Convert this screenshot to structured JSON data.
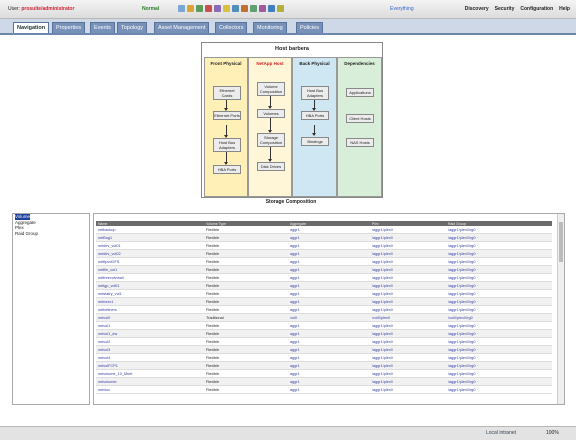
{
  "header": {
    "user_label": "User:",
    "user_value": "prosuite/administrator",
    "mode": "Normal",
    "everything": "Everything",
    "links": [
      "Discovery",
      "Security",
      "Configuration",
      "Help"
    ]
  },
  "tabs": [
    "Navigation",
    "Properties",
    "Events",
    "Topology",
    "Asset Management",
    "Collectors",
    "Monitoring",
    "Policies"
  ],
  "diagram": {
    "title": "Host barbera",
    "columns": [
      {
        "title": "Front Physical",
        "items": [
          "Ethernet Cards",
          "Ethernet Ports",
          "Host Bus Adapters",
          "HBA Ports"
        ]
      },
      {
        "title": "NetApp Host",
        "items": [
          "Volume Composition",
          "Volumes",
          "Storage Composition",
          "Disk Drives"
        ]
      },
      {
        "title": "Back Physical",
        "items": [
          "Host Bus Adapters",
          "HBA Ports",
          "Bindings"
        ]
      },
      {
        "title": "Dependencies",
        "items": [
          "Applications",
          "Client Hosts",
          "NAS Hosts"
        ]
      }
    ]
  },
  "storage_title": "Storage Composition",
  "tree": {
    "items": [
      "Volume",
      "Aggregate",
      "Plex",
      "Raid Group"
    ]
  },
  "table": {
    "headers": [
      "Name",
      "Volume Type",
      "Aggregate",
      "Plex",
      "Raid Group"
    ],
    "rows": [
      [
        "netbackup",
        "Flexible",
        "aggr1",
        "/aggr1/plex0",
        "/aggr1/plex0/rg0"
      ],
      [
        "netBug1",
        "Flexible",
        "aggr1",
        "/aggr1/plex0",
        "/aggr1/plex0/rg0"
      ],
      [
        "netdev_vol01",
        "Flexible",
        "aggr1",
        "/aggr1/plex0",
        "/aggr1/plex0/rg0"
      ],
      [
        "netdev_vol02",
        "Flexible",
        "aggr1",
        "/aggr1/plex0",
        "/aggr1/plex0/rg0"
      ],
      [
        "netftpvol2FS",
        "Flexible",
        "aggr1",
        "/aggr1/plex0",
        "/aggr1/plex0/rg0"
      ],
      [
        "netfile_vol1",
        "Flexible",
        "aggr1",
        "/aggr1/plex0",
        "/aggr1/plex0/rg0"
      ],
      [
        "netfreevolvmall",
        "Flexible",
        "aggr1",
        "/aggr1/plex0",
        "/aggr1/plex0/rg0"
      ],
      [
        "netigp_vol01",
        "Flexible",
        "aggr1",
        "/aggr1/plex0",
        "/aggr1/plex0/rg0"
      ],
      [
        "netstatry_vol1",
        "Flexible",
        "aggr1",
        "/aggr1/plex0",
        "/aggr1/plex0/rg0"
      ],
      [
        "netnexv1",
        "Flexible",
        "aggr1",
        "/aggr1/plex0",
        "/aggr1/plex0/rg0"
      ],
      [
        "nethetiners",
        "Flexible",
        "aggr1",
        "/aggr1/plex0",
        "/aggr1/plex0/rg0"
      ],
      [
        "netvol0",
        "Traditional",
        "vol0",
        "/vol0/plex0",
        "/vol0/plex0/rg0"
      ],
      [
        "netvol1",
        "Flexible",
        "aggr1",
        "/aggr1/plex0",
        "/aggr1/plex0/rg0"
      ],
      [
        "netvol1_ew",
        "Flexible",
        "aggr1",
        "/aggr1/plex0",
        "/aggr1/plex0/rg0"
      ],
      [
        "netvol2",
        "Flexible",
        "aggr1",
        "/aggr1/plex0",
        "/aggr1/plex0/rg0"
      ],
      [
        "netvol3",
        "Flexible",
        "aggr1",
        "/aggr1/plex0",
        "/aggr1/plex0/rg0"
      ],
      [
        "netvol4",
        "Flexible",
        "aggr1",
        "/aggr1/plex0",
        "/aggr1/plex0/rg0"
      ],
      [
        "netvolFCP1",
        "Flexible",
        "aggr1",
        "/aggr1/plex0",
        "/aggr1/plex0/rg0"
      ],
      [
        "netvolume_10_Mnet",
        "Flexible",
        "aggr1",
        "/aggr1/plex0",
        "/aggr1/plex0/rg0"
      ],
      [
        "netvolumer",
        "Flexible",
        "aggr1",
        "/aggr1/plex0",
        "/aggr1/plex0/rg0"
      ],
      [
        "netvlux",
        "Flexible",
        "aggr1",
        "/aggr1/plex0",
        "/aggr1/plex0/rg0"
      ]
    ]
  },
  "status": {
    "zone": "Local intranet",
    "zoom": "100%"
  },
  "icons": [
    "toolbar-icon-1",
    "toolbar-icon-2",
    "toolbar-icon-3",
    "toolbar-icon-4",
    "toolbar-icon-5",
    "toolbar-icon-6",
    "toolbar-icon-7",
    "toolbar-icon-8",
    "toolbar-icon-9",
    "toolbar-icon-10",
    "toolbar-icon-11",
    "toolbar-icon-12"
  ],
  "colors": {
    "tab_active_border": "#6d86ad",
    "front_col": "#fff0b8",
    "netapp_col": "#fff6d8",
    "back_col": "#cfe6f3",
    "deps_col": "#d8eed8"
  }
}
